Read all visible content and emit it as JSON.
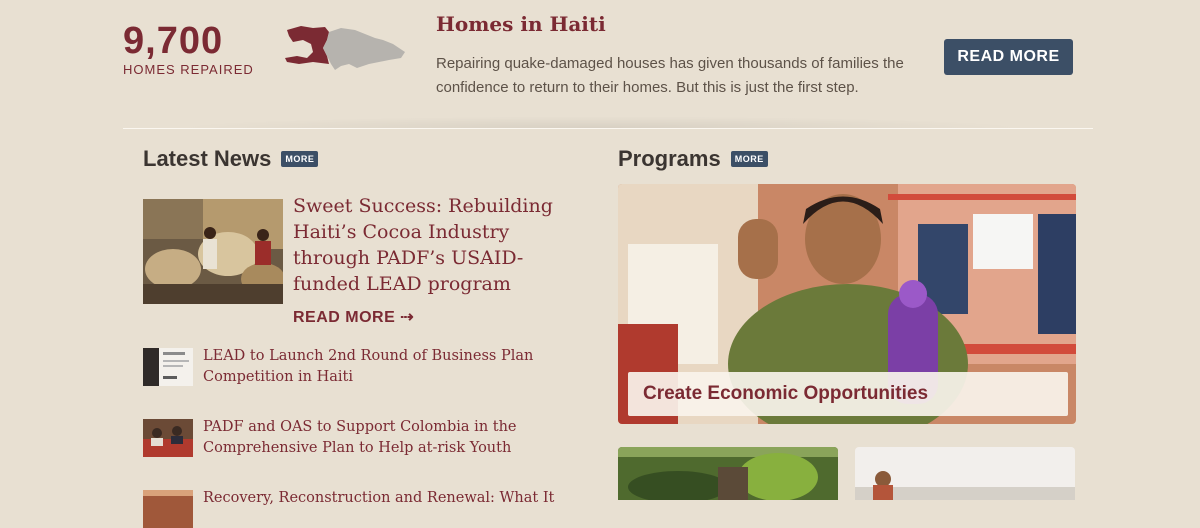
{
  "stat": {
    "number": "9,700",
    "label": "HOMES REPAIRED"
  },
  "feature": {
    "title": "Homes in Haiti",
    "text": "Repairing quake-damaged houses has given thousands of families the confidence to return to their homes. But this is just the first step.",
    "button_label": "READ MORE"
  },
  "latest_news": {
    "heading": "Latest News",
    "more_label": "MORE",
    "featured": {
      "title": "Sweet Success: Rebuilding Haiti’s Cocoa Industry through PADF’s USAID-funded LEAD program",
      "read_more": "READ MORE ⇢"
    },
    "items": [
      {
        "title": "LEAD to Launch 2nd Round of Business Plan Competition in Haiti"
      },
      {
        "title": "PADF and OAS to Support Colombia in the Comprehensive Plan to Help at-risk Youth"
      },
      {
        "title": "Recovery, Reconstruction and Renewal: What It"
      }
    ]
  },
  "programs": {
    "heading": "Programs",
    "more_label": "MORE",
    "featured_caption": "Create Economic Opportunities"
  },
  "colors": {
    "accent": "#7b2a33",
    "button": "#3c4f66",
    "background": "#e8e0d2"
  }
}
